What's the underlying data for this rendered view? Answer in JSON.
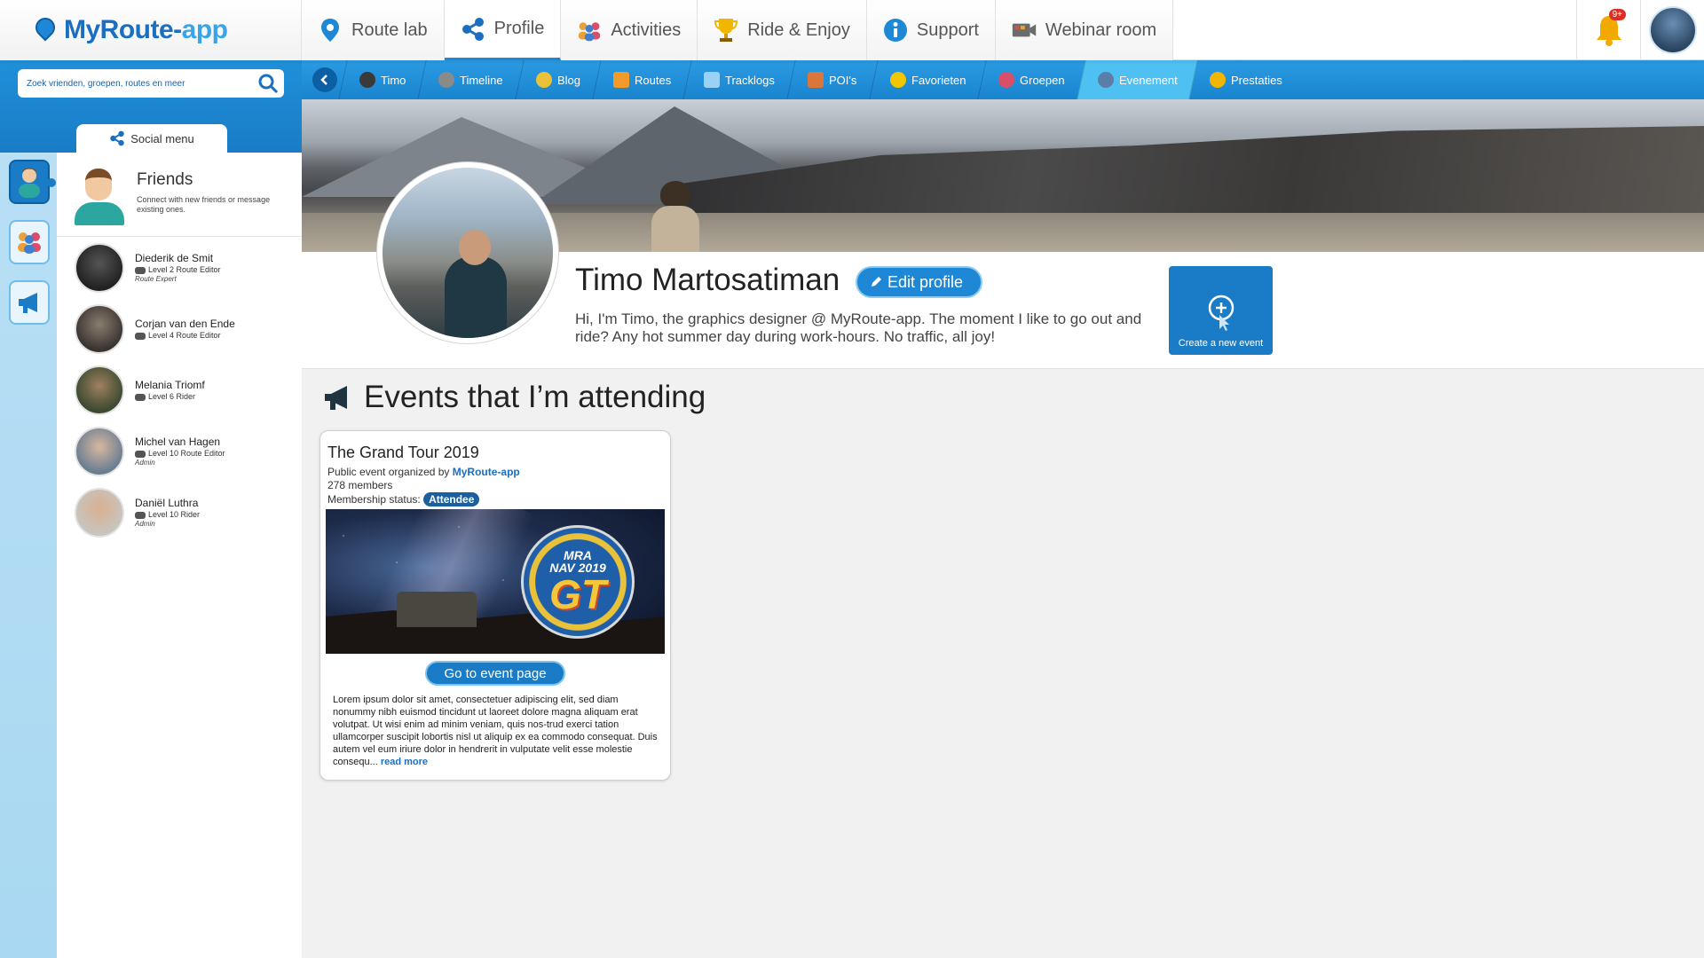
{
  "logo": {
    "text_main": "MyRoute-",
    "text_accent": "app"
  },
  "nav": [
    {
      "label": "Route lab",
      "icon": "map-pin-icon"
    },
    {
      "label": "Profile",
      "icon": "share-icon"
    },
    {
      "label": "Activities",
      "icon": "people-icon"
    },
    {
      "label": "Ride & Enjoy",
      "icon": "trophy-icon"
    },
    {
      "label": "Support",
      "icon": "info-icon"
    },
    {
      "label": "Webinar room",
      "icon": "video-camera-icon"
    }
  ],
  "notifications": {
    "badge": "9+"
  },
  "search": {
    "placeholder": "Zoek vrienden, groepen, routes en meer"
  },
  "social_tab": {
    "label": "Social menu"
  },
  "friends": {
    "title": "Friends",
    "subtitle": "Connect with new friends or message existing ones.",
    "list": [
      {
        "name": "Diederik de Smit",
        "level": "Level 2 Route Editor",
        "role": "Route Expert"
      },
      {
        "name": "Corjan van den Ende",
        "level": "Level 4 Route Editor",
        "role": ""
      },
      {
        "name": "Melania Triomf",
        "level": "Level 6 Rider",
        "role": ""
      },
      {
        "name": "Michel van Hagen",
        "level": "Level 10 Route Editor",
        "role": "Admin"
      },
      {
        "name": "Daniël Luthra",
        "level": "Level 10 Rider",
        "role": "Admin"
      }
    ]
  },
  "subnav": [
    {
      "label": "Timo"
    },
    {
      "label": "Timeline"
    },
    {
      "label": "Blog"
    },
    {
      "label": "Routes"
    },
    {
      "label": "Tracklogs"
    },
    {
      "label": "POI's"
    },
    {
      "label": "Favorieten"
    },
    {
      "label": "Groepen"
    },
    {
      "label": "Evenement"
    },
    {
      "label": "Prestaties"
    }
  ],
  "profile": {
    "name": "Timo Martosatiman",
    "edit_label": "Edit profile",
    "bio": "Hi, I'm Timo, the graphics designer @ MyRoute-app. The moment I like to go out and ride? Any hot summer day during work-hours. No traffic, all joy!",
    "create_event_label": "Create a new event"
  },
  "events": {
    "section_title": "Events that I’m attending",
    "items": [
      {
        "title": "The Grand Tour 2019",
        "organized_prefix": "Public event organized by",
        "organizer": "MyRoute-app",
        "members": "278 members",
        "status_label": "Membership status:",
        "status": "Attendee",
        "image_line1": "MRA",
        "image_line2": "NAV 2019",
        "image_line3": "GT",
        "button": "Go to event page",
        "description": "Lorem ipsum dolor sit amet, consectetuer adipiscing elit, sed diam nonummy nibh euismod tincidunt ut laoreet dolore magna aliquam erat volutpat. Ut wisi enim ad minim veniam, quis nos-trud exerci tation ullamcorper suscipit lobortis nisl ut aliquip ex ea commodo consequat. Duis autem vel eum iriure dolor in hendrerit in vulputate velit esse molestie consequ...",
        "read_more": "read more"
      }
    ]
  },
  "colors": {
    "brand": "#1a7cc6",
    "accent": "#4fc0f2",
    "badge": "#d93025"
  }
}
